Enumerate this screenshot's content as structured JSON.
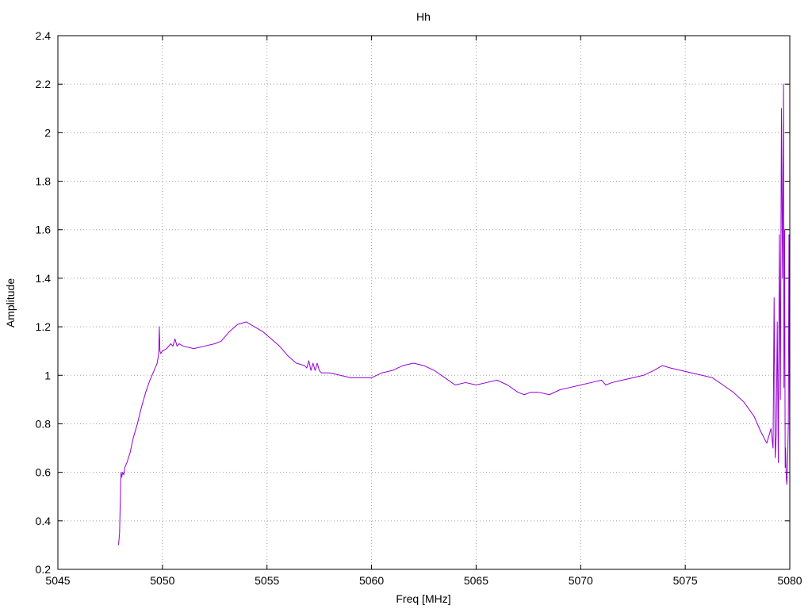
{
  "chart_data": {
    "type": "line",
    "title": "Hh",
    "xlabel": "Freq [MHz]",
    "ylabel": "Amplitude",
    "xlim": [
      5045,
      5080
    ],
    "ylim": [
      0.2,
      2.4
    ],
    "x_ticks": [
      5045,
      5050,
      5055,
      5060,
      5065,
      5070,
      5075,
      5080
    ],
    "y_ticks": [
      0.2,
      0.4,
      0.6,
      0.8,
      1,
      1.2,
      1.4,
      1.6,
      1.8,
      2,
      2.2,
      2.4
    ],
    "x_tick_labels": [
      "5045",
      "5050",
      "5055",
      "5060",
      "5065",
      "5070",
      "5075",
      "5080"
    ],
    "y_tick_labels": [
      "0.2",
      "0.4",
      "0.6",
      "0.8",
      "1",
      "1.2",
      "1.4",
      "1.6",
      "1.8",
      "2",
      "2.2",
      "2.4"
    ],
    "grid": true,
    "series": [
      {
        "color": "#9400d3",
        "x": [
          5047.9,
          5047.95,
          5048.0,
          5048.02,
          5048.05,
          5048.1,
          5048.15,
          5048.2,
          5048.3,
          5048.45,
          5048.6,
          5048.8,
          5049.0,
          5049.2,
          5049.4,
          5049.6,
          5049.75,
          5049.82,
          5049.85,
          5049.88,
          5049.92,
          5050.0,
          5050.2,
          5050.4,
          5050.5,
          5050.6,
          5050.7,
          5050.8,
          5051.0,
          5051.5,
          5052.0,
          5052.5,
          5052.8,
          5053.2,
          5053.6,
          5054.0,
          5054.4,
          5054.8,
          5055.2,
          5055.6,
          5056.0,
          5056.4,
          5056.8,
          5056.9,
          5057.0,
          5057.1,
          5057.2,
          5057.3,
          5057.4,
          5057.5,
          5057.6,
          5058.0,
          5058.5,
          5059.0,
          5059.5,
          5060.0,
          5060.5,
          5061.0,
          5061.5,
          5062.0,
          5062.5,
          5063.0,
          5063.5,
          5064.0,
          5064.5,
          5065.0,
          5065.5,
          5066.0,
          5066.5,
          5067.0,
          5067.3,
          5067.6,
          5068.0,
          5068.5,
          5069.0,
          5069.5,
          5070.0,
          5070.5,
          5071.0,
          5071.2,
          5071.5,
          5072.0,
          5072.5,
          5073.0,
          5073.5,
          5073.9,
          5074.3,
          5074.8,
          5075.3,
          5075.8,
          5076.3,
          5076.8,
          5077.3,
          5077.8,
          5078.3,
          5078.6,
          5078.9,
          5079.1,
          5079.2,
          5079.25,
          5079.3,
          5079.35,
          5079.4,
          5079.45,
          5079.5,
          5079.55,
          5079.6,
          5079.65,
          5079.7,
          5079.72,
          5079.75,
          5079.78,
          5079.8,
          5079.83,
          5079.86,
          5079.9,
          5079.93,
          5079.96,
          5080.0
        ],
        "y": [
          0.3,
          0.35,
          0.55,
          0.6,
          0.58,
          0.6,
          0.59,
          0.62,
          0.64,
          0.68,
          0.74,
          0.8,
          0.87,
          0.93,
          0.98,
          1.02,
          1.05,
          1.09,
          1.2,
          1.1,
          1.09,
          1.1,
          1.11,
          1.13,
          1.12,
          1.15,
          1.12,
          1.13,
          1.12,
          1.11,
          1.12,
          1.13,
          1.14,
          1.18,
          1.21,
          1.22,
          1.2,
          1.18,
          1.15,
          1.12,
          1.08,
          1.05,
          1.04,
          1.03,
          1.06,
          1.02,
          1.05,
          1.02,
          1.05,
          1.02,
          1.01,
          1.01,
          1.0,
          0.99,
          0.99,
          0.99,
          1.01,
          1.02,
          1.04,
          1.05,
          1.04,
          1.02,
          0.99,
          0.96,
          0.97,
          0.96,
          0.97,
          0.98,
          0.96,
          0.93,
          0.92,
          0.93,
          0.93,
          0.92,
          0.94,
          0.95,
          0.96,
          0.97,
          0.98,
          0.96,
          0.97,
          0.98,
          0.99,
          1.0,
          1.02,
          1.04,
          1.03,
          1.02,
          1.01,
          1.0,
          0.99,
          0.96,
          0.93,
          0.89,
          0.83,
          0.77,
          0.72,
          0.78,
          0.7,
          1.32,
          0.66,
          0.75,
          1.22,
          0.64,
          1.58,
          0.9,
          2.1,
          1.4,
          2.2,
          0.95,
          1.6,
          0.62,
          0.7,
          0.58,
          0.55,
          0.65,
          0.8,
          1.58,
          0.6
        ]
      }
    ]
  }
}
